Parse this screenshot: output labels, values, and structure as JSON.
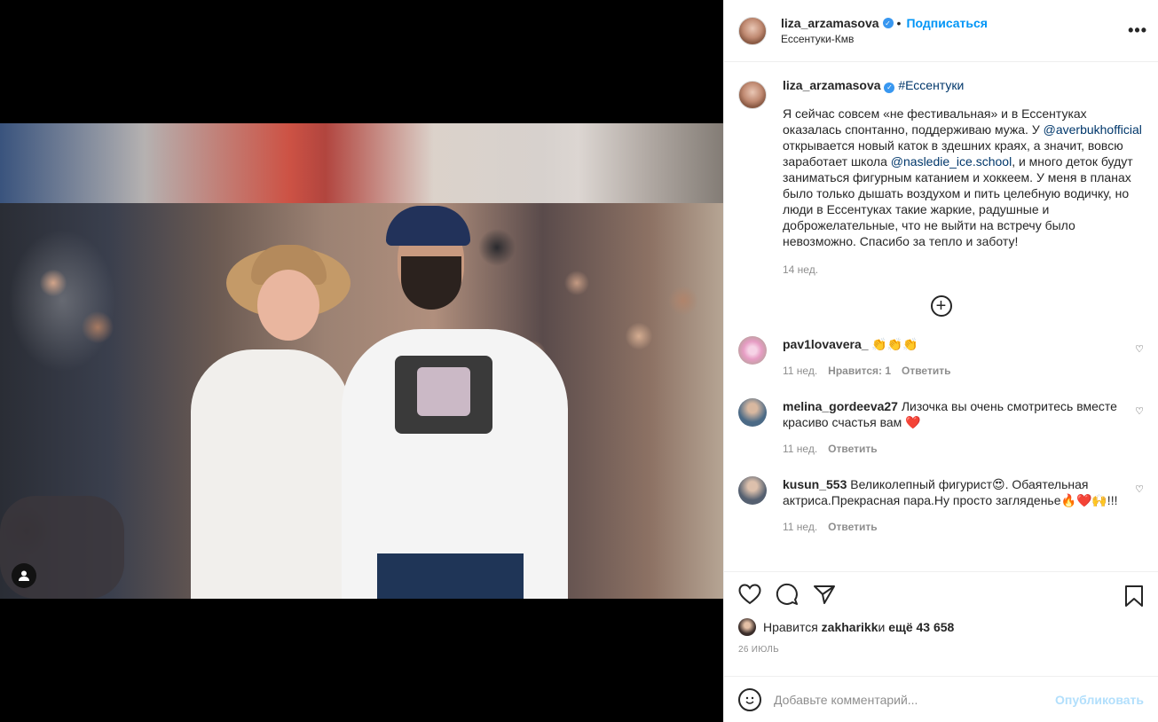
{
  "post": {
    "username": "liza_arzamasova",
    "verified_mark": "✓",
    "follow_label": "Подписаться",
    "dot": "•",
    "location": "Ессентуки-Кмв",
    "more_label": "•••"
  },
  "caption": {
    "username": "liza_arzamasova",
    "hashtag": "#Ессентуки",
    "text_part1": "Я сейчас совсем «не фестивальная» и в Ессентуках оказалась спонтанно, поддерживаю мужа. У ",
    "mention1": "@averbukhofficial",
    "text_part2": " открывается новый каток в здешних краях, а значит, вовсю заработает школа ",
    "mention2": "@nasledie_ice.school",
    "text_part3": ", и много деток будут заниматься фигурным катанием и хоккеем. У меня в планах было только дышать воздухом и пить целебную водичку, но люди в Ессентуках такие жаркие, радушные и доброжелательные, что не выйти на встречу было невозможно. Спасибо за тепло и заботу!",
    "time": "14 нед."
  },
  "load_more_label": "+",
  "comments": [
    {
      "username": "pav1lovavera_",
      "text": "👏👏👏",
      "time": "11 нед.",
      "likes": "Нравится: 1",
      "reply": "Ответить"
    },
    {
      "username": "melina_gordeeva27",
      "text": "Лизочка вы очень смотритесь вместе красиво счастья вам ❤️",
      "time": "11 нед.",
      "likes": "",
      "reply": "Ответить"
    },
    {
      "username": "kusun_553",
      "text": "Великолепный фигурист😍. Обаятельная актриса.Прекрасная пара.Ну просто загляденье🔥❤️🙌!!!",
      "time": "11 нед.",
      "likes": "",
      "reply": "Ответить"
    }
  ],
  "likes": {
    "prefix": "Нравится ",
    "user": "zakharikk",
    "middle": " и ",
    "count": "ещё 43 658"
  },
  "date": "26 ИЮЛЬ",
  "add_comment": {
    "placeholder": "Добавьте комментарий...",
    "post_label": "Опубликовать"
  },
  "icons": {
    "like": "heart-icon",
    "comment": "comment-icon",
    "share": "share-icon",
    "save": "bookmark-icon",
    "emoji": "emoji-icon",
    "user_tag": "user-tag-icon"
  },
  "colors": {
    "link": "#00376b",
    "follow": "#0095f6",
    "verified": "#3897f0",
    "muted": "#8e8e8e",
    "post_disabled": "#b2dffc"
  }
}
